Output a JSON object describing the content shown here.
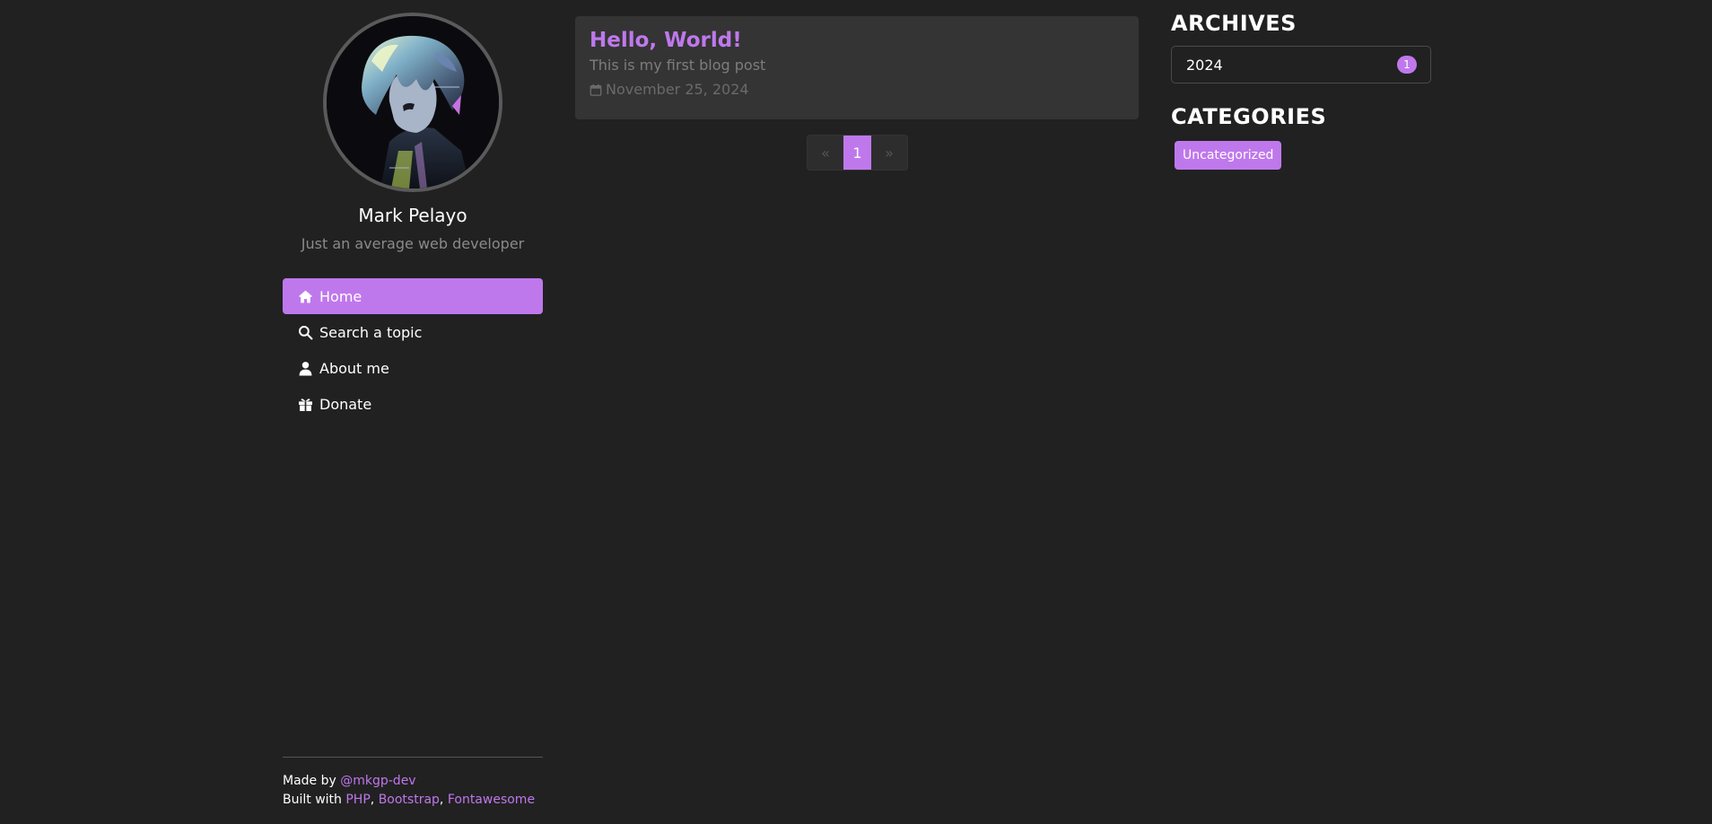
{
  "profile": {
    "name": "Mark Pelayo",
    "tagline": "Just an average web developer"
  },
  "nav": {
    "items": [
      {
        "label": "Home",
        "icon": "home-icon",
        "active": true
      },
      {
        "label": "Search a topic",
        "icon": "search-icon",
        "active": false
      },
      {
        "label": "About me",
        "icon": "user-icon",
        "active": false
      },
      {
        "label": "Donate",
        "icon": "gift-icon",
        "active": false
      }
    ]
  },
  "footer": {
    "made_by_prefix": "Made by ",
    "made_by_link": "@mkgp-dev",
    "built_with_prefix": "Built with ",
    "tech": [
      "PHP",
      "Bootstrap",
      "Fontawesome"
    ],
    "separator": ", "
  },
  "posts": [
    {
      "title": "Hello, World!",
      "subtitle": "This is my first blog post",
      "date": "November 25, 2024"
    }
  ],
  "pagination": {
    "prev": "«",
    "current": "1",
    "next": "»"
  },
  "archives": {
    "title": "ARCHIVES",
    "items": [
      {
        "label": "2024",
        "count": "1"
      }
    ]
  },
  "categories": {
    "title": "CATEGORIES",
    "items": [
      "Uncategorized"
    ]
  },
  "colors": {
    "background": "#212121",
    "accent": "#bf78ec",
    "card": "#343434",
    "muted": "#7d7d7d"
  }
}
